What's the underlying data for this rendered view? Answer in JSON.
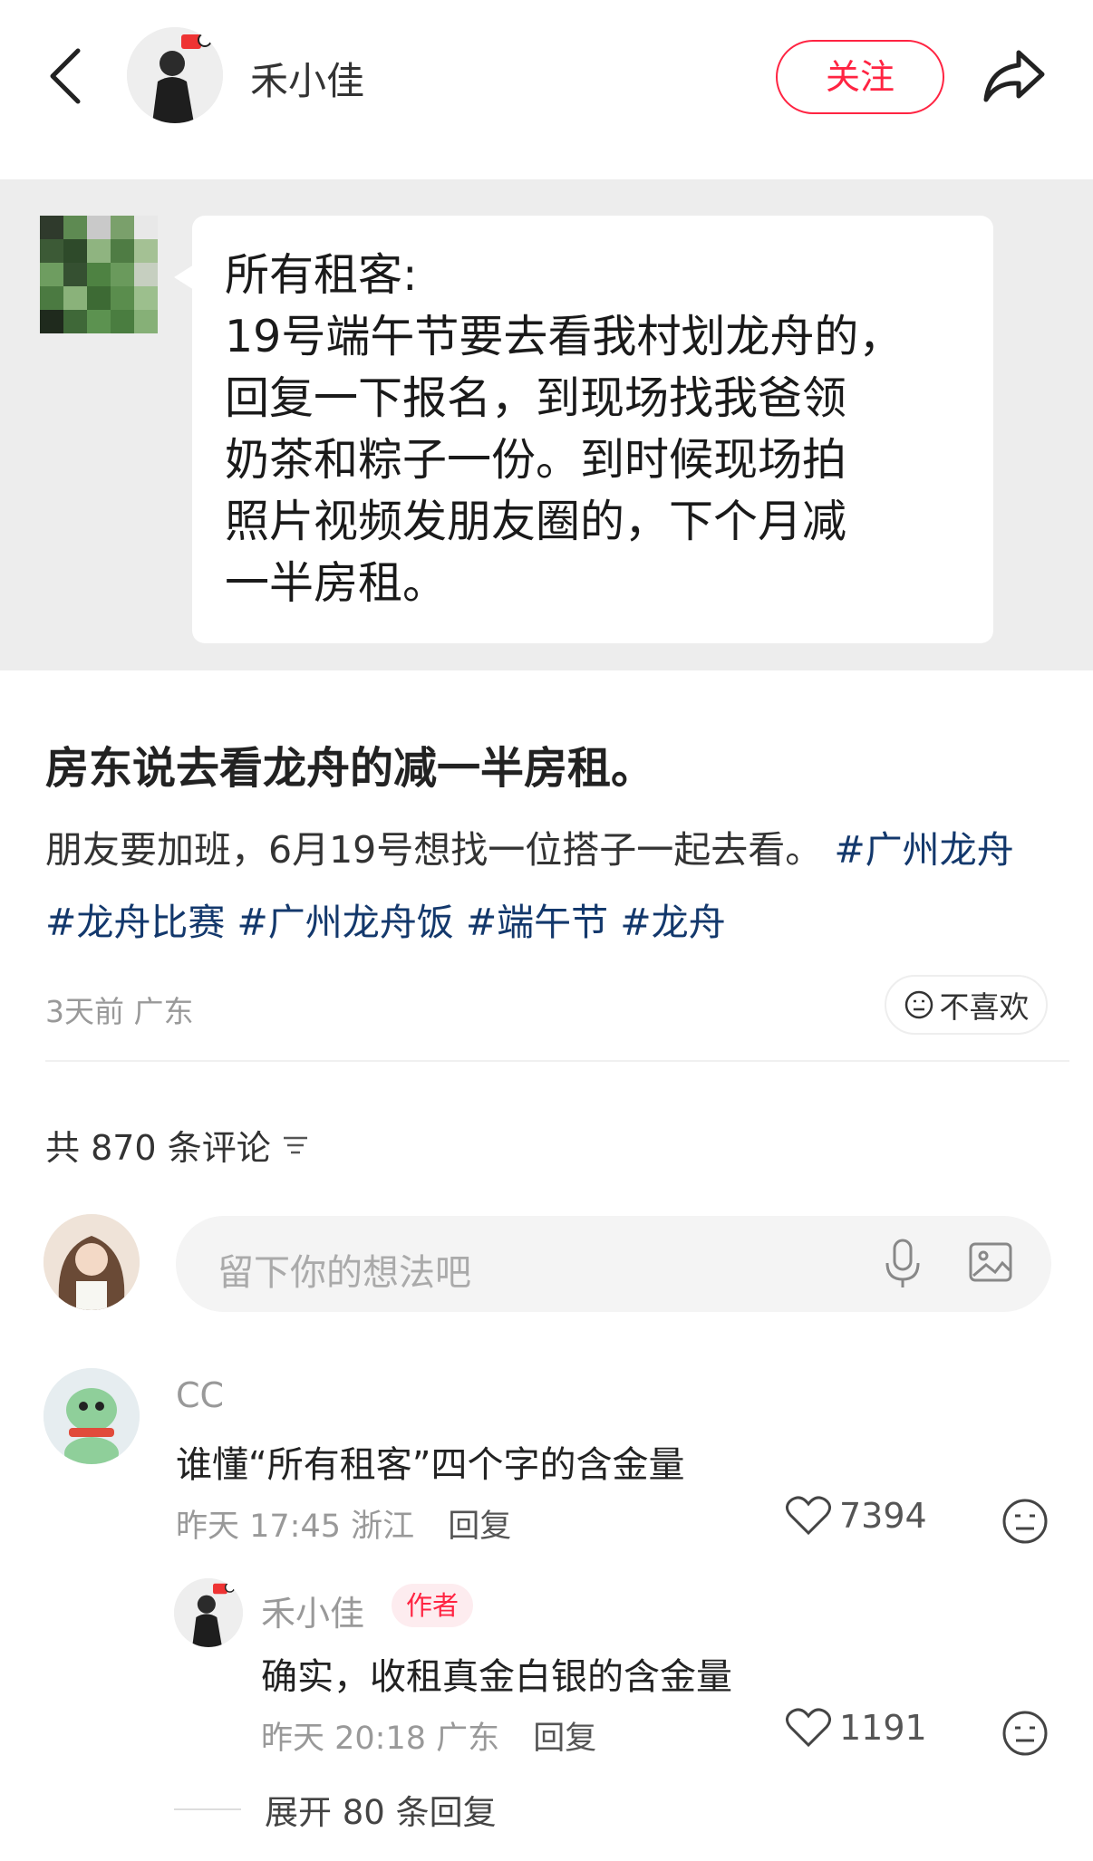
{
  "header": {
    "author_name": "禾小佳",
    "follow_label": "关注"
  },
  "message": {
    "text": "所有租客:\n19号端午节要去看我村划龙舟的，\n回复一下报名，到现场找我爸领\n奶茶和粽子一份。到时候现场拍\n照片视频发朋友圈的，下个月减\n一半房租。"
  },
  "post": {
    "title": "房东说去看龙舟的减一半房租。",
    "body": "朋友要加班，6月19号想找一位搭子一起去看。",
    "tags": [
      "#广州龙舟",
      "#龙舟比赛",
      "#广州龙舟饭",
      "#端午节",
      "#龙舟"
    ],
    "time": "3天前",
    "location": "广东",
    "dislike_label": "不喜欢"
  },
  "comments_section": {
    "count_label": "共 870 条评论",
    "input_placeholder": "留下你的想法吧"
  },
  "comment": {
    "name": "CC",
    "text": "谁懂“所有租客”四个字的含金量",
    "time": "昨天 17:45",
    "location": "浙江",
    "reply_label": "回复",
    "likes": "7394"
  },
  "reply": {
    "name": "禾小佳",
    "author_tag": "作者",
    "text": "确实，收租真金白银的含金量",
    "time": "昨天 20:18",
    "location": "广东",
    "reply_label": "回复",
    "likes": "1191"
  },
  "expand_label": "展开 80 条回复",
  "icons": {
    "back": "chevron-left-icon",
    "share": "share-arrow-icon",
    "filter": "sort-lines-icon",
    "mic": "microphone-icon",
    "image": "image-icon",
    "like": "heart-icon",
    "dislike": "meh-face-icon"
  },
  "colors": {
    "accent": "#ff2442",
    "tag": "#13386c"
  }
}
